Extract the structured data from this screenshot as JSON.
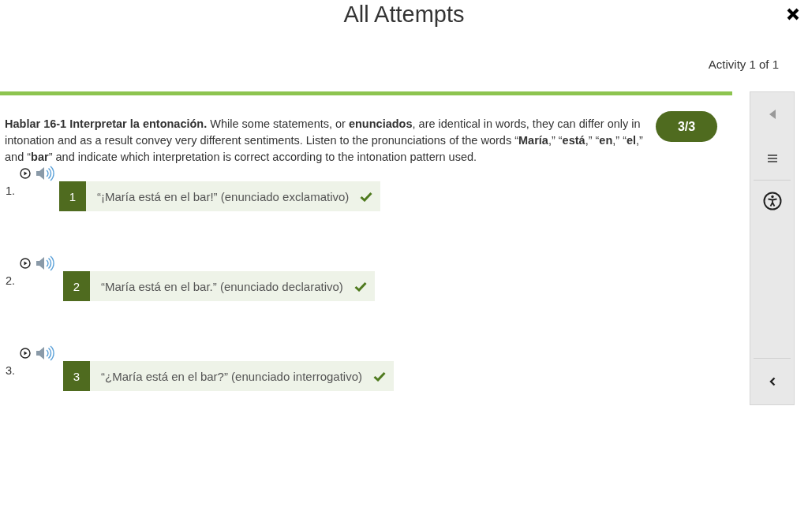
{
  "window": {
    "title": "All Attempts"
  },
  "activity_counter": "Activity 1 of 1",
  "instructions": "**Hablar 16-1 Interpretar la entonación.** While some statements, or **enunciados**, are identical in words, they can differ only in intonation and as a result convey very different sentiments. Listen to the pronunciations of the words “**María**,” “**está**,” “**en**,” “**el**,” and “**bar**” and indicate which interpretation is correct according to the intonation pattern used.",
  "score": "3/3",
  "questions": [
    {
      "number": "1.",
      "choice_number": "1",
      "answer": "“¡María está en el bar!” (enunciado exclamativo)",
      "correct": true
    },
    {
      "number": "2.",
      "choice_number": "2",
      "answer": "“María está en el bar.” (enunciado declarativo)",
      "correct": true
    },
    {
      "number": "3.",
      "choice_number": "3",
      "answer": "“¿María está en el bar?” (enunciado interrogativo)",
      "correct": true
    }
  ]
}
